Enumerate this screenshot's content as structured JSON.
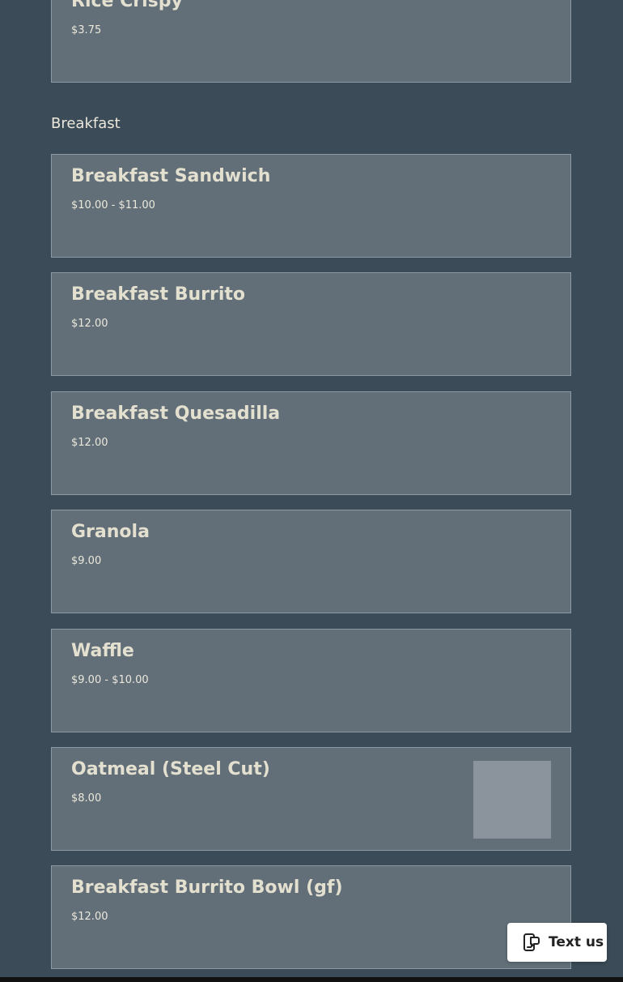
{
  "top_item": {
    "name": "Rice Crispy",
    "price": "$3.75"
  },
  "section": {
    "title": "Breakfast"
  },
  "items": [
    {
      "name": "Breakfast Sandwich",
      "price": "$10.00 - $11.00"
    },
    {
      "name": "Breakfast Burrito",
      "price": "$12.00"
    },
    {
      "name": "Breakfast Quesadilla",
      "price": "$12.00"
    },
    {
      "name": "Granola",
      "price": "$9.00"
    },
    {
      "name": "Waffle",
      "price": "$9.00 - $10.00"
    },
    {
      "name": "Oatmeal (Steel Cut)",
      "price": "$8.00"
    },
    {
      "name": "Breakfast Burrito Bowl (gf)",
      "price": "$12.00"
    }
  ],
  "text_us": {
    "label": "Text us",
    "icon": "chat-phone-icon"
  },
  "colors": {
    "background": "#3b4b57",
    "card": "#626f78",
    "card_border": "#8e9aa3",
    "text": "#e4e0d0",
    "image_placeholder": "#8b949c"
  }
}
